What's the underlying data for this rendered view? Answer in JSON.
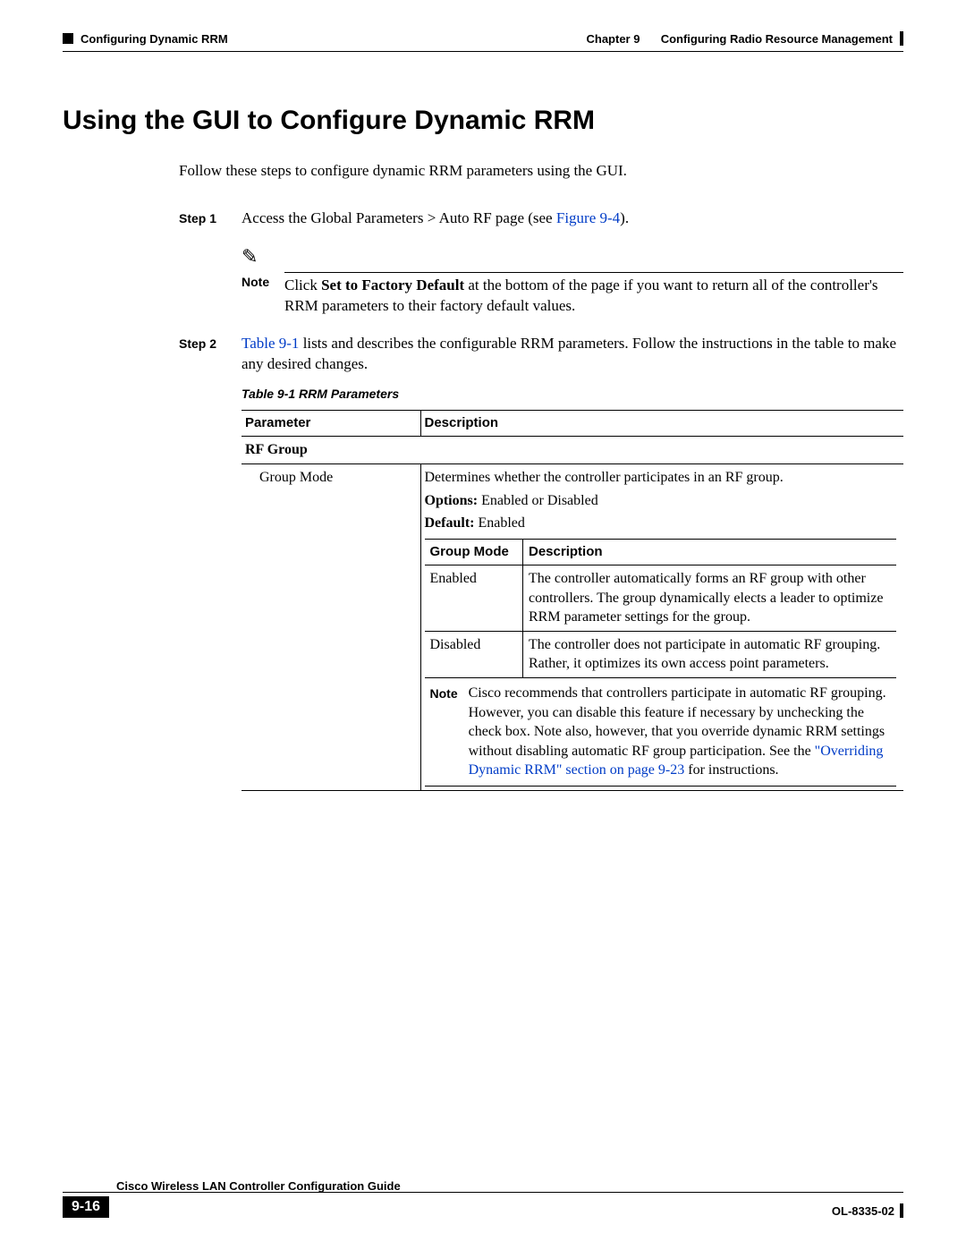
{
  "header": {
    "left_section": "Configuring Dynamic RRM",
    "right_chapter": "Chapter 9",
    "right_title": "Configuring Radio Resource Management"
  },
  "title": "Using the GUI to Configure Dynamic RRM",
  "intro": "Follow these steps to configure dynamic RRM parameters using the GUI.",
  "step1": {
    "label": "Step 1",
    "text_before": "Access the Global Parameters > Auto RF page (see ",
    "link": "Figure 9-4",
    "text_after": ")."
  },
  "note1": {
    "label": "Note",
    "text_before": "Click ",
    "bold": "Set to Factory Default",
    "text_after": " at the bottom of the page if you want to return all of the controller's RRM parameters to their factory default values."
  },
  "step2": {
    "label": "Step 2",
    "link": "Table 9-1",
    "text_after": " lists and describes the configurable RRM parameters. Follow the instructions in the table to make any desired changes."
  },
  "table": {
    "caption": "Table 9-1    RRM Parameters",
    "col1": "Parameter",
    "col2": "Description",
    "section": "RF Group",
    "row1_param": "Group Mode",
    "row1_desc_line1": "Determines whether the controller participates in an RF group.",
    "row1_options_label": "Options:",
    "row1_options_val": " Enabled or Disabled",
    "row1_default_label": "Default:",
    "row1_default_val": " Enabled",
    "inner": {
      "col1": "Group Mode",
      "col2": "Description",
      "r1c1": "Enabled",
      "r1c2": "The controller automatically forms an RF group with other controllers. The group dynamically elects a leader to optimize RRM parameter settings for the group.",
      "r2c1": "Disabled",
      "r2c2": "The controller does not participate in automatic RF grouping. Rather, it optimizes its own access point parameters.",
      "note_label": "Note",
      "note_text_before": "Cisco recommends that controllers participate in automatic RF grouping. However, you can disable this feature if necessary by unchecking the check box. Note also, however, that you override dynamic RRM settings without disabling automatic RF group participation. See the ",
      "note_link": "\"Overriding Dynamic RRM\" section on page 9-23",
      "note_text_after": " for instructions."
    }
  },
  "footer": {
    "guide": "Cisco Wireless LAN Controller Configuration Guide",
    "page": "9-16",
    "doc": "OL-8335-02"
  }
}
